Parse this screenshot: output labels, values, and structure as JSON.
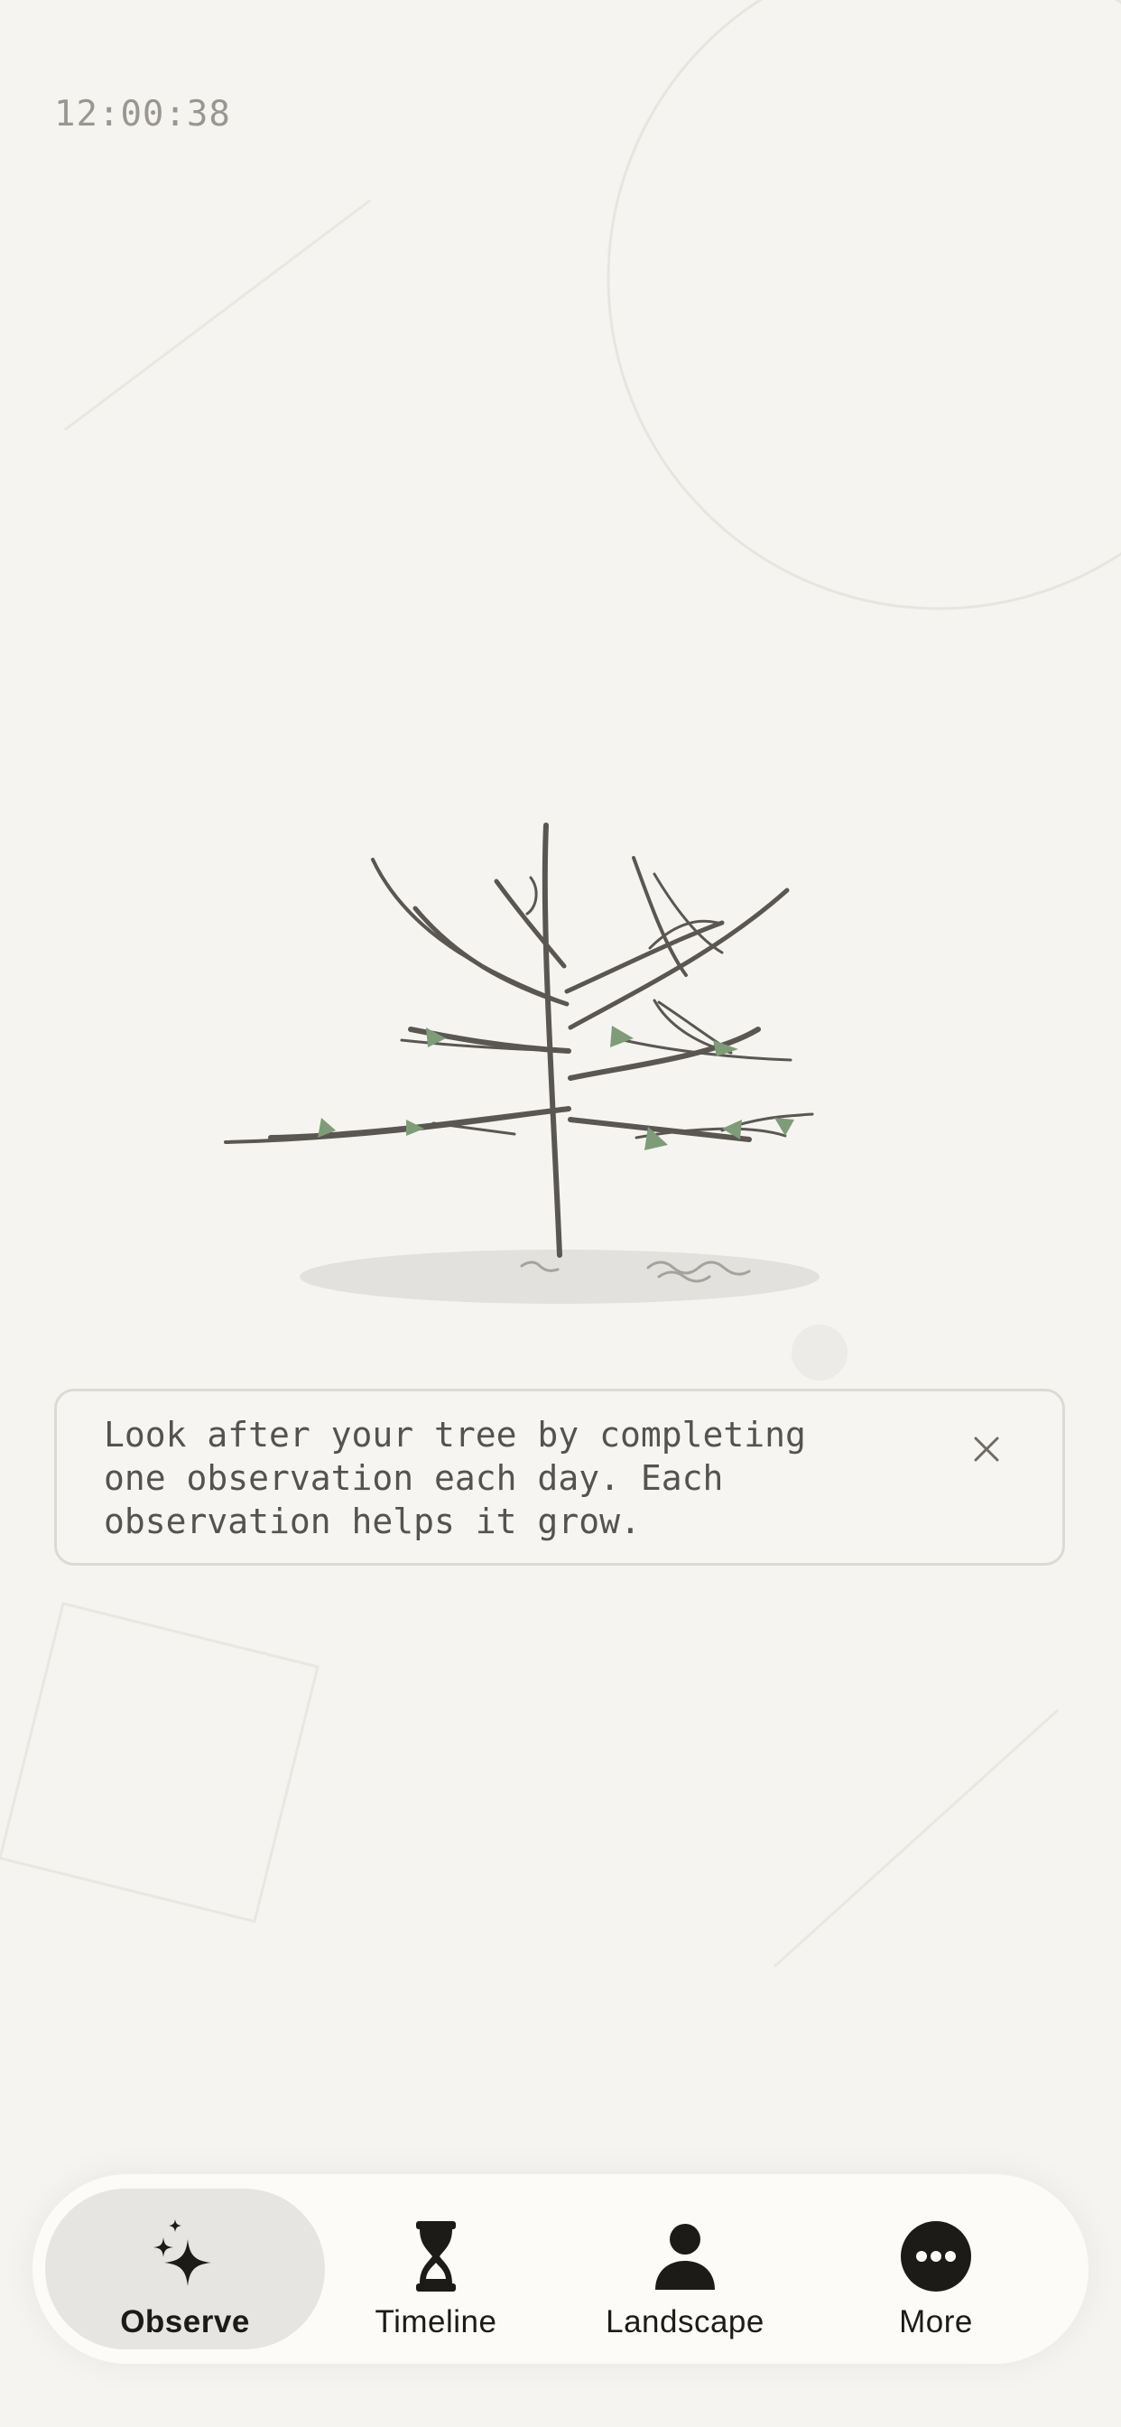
{
  "status": {
    "time": "12:00:38"
  },
  "onboarding": {
    "message": "Look after your tree by completing\none observation each day. Each\nobservation helps it grow.",
    "close_icon": "close-icon"
  },
  "tabbar": {
    "active": "observe",
    "tabs": [
      {
        "id": "observe",
        "label": "Observe",
        "icon": "sparkles-icon"
      },
      {
        "id": "timeline",
        "label": "Timeline",
        "icon": "hourglass-icon"
      },
      {
        "id": "landscape",
        "label": "Landscape",
        "icon": "person-icon"
      },
      {
        "id": "more",
        "label": "More",
        "icon": "ellipsis-circle-icon"
      }
    ]
  },
  "colors": {
    "background": "#f5f4f0",
    "branch": "#5a5753",
    "leaf": "#7f9c78",
    "active_tab": "#e6e5e1",
    "text": "#1c1b18"
  }
}
